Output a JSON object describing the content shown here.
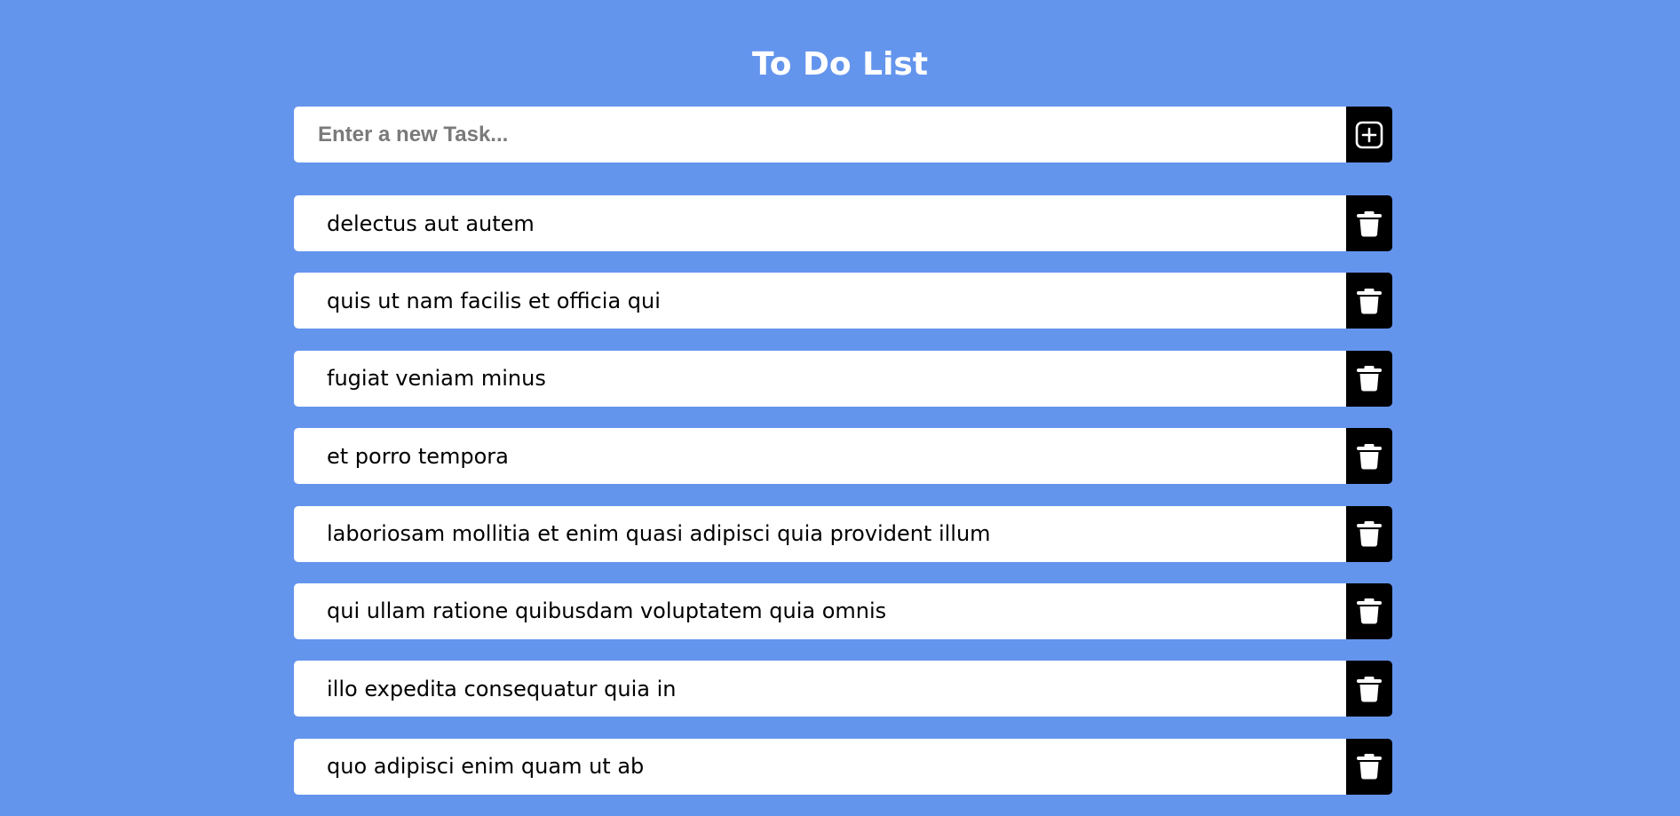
{
  "header": {
    "title": "To Do List"
  },
  "new_task": {
    "placeholder": "Enter a new Task...",
    "value": "",
    "add_icon": "plus-square-icon"
  },
  "tasks": [
    {
      "text": "delectus aut autem",
      "delete_icon": "trash-icon"
    },
    {
      "text": "quis ut nam facilis et officia qui",
      "delete_icon": "trash-icon"
    },
    {
      "text": "fugiat veniam minus",
      "delete_icon": "trash-icon"
    },
    {
      "text": "et porro tempora",
      "delete_icon": "trash-icon"
    },
    {
      "text": "laboriosam mollitia et enim quasi adipisci quia provident illum",
      "delete_icon": "trash-icon"
    },
    {
      "text": "qui ullam ratione quibusdam voluptatem quia omnis",
      "delete_icon": "trash-icon"
    },
    {
      "text": "illo expedita consequatur quia in",
      "delete_icon": "trash-icon"
    },
    {
      "text": "quo adipisci enim quam ut ab",
      "delete_icon": "trash-icon"
    }
  ],
  "colors": {
    "background": "#6495ed",
    "card": "#ffffff",
    "button": "#000000",
    "title": "#ffffff"
  }
}
